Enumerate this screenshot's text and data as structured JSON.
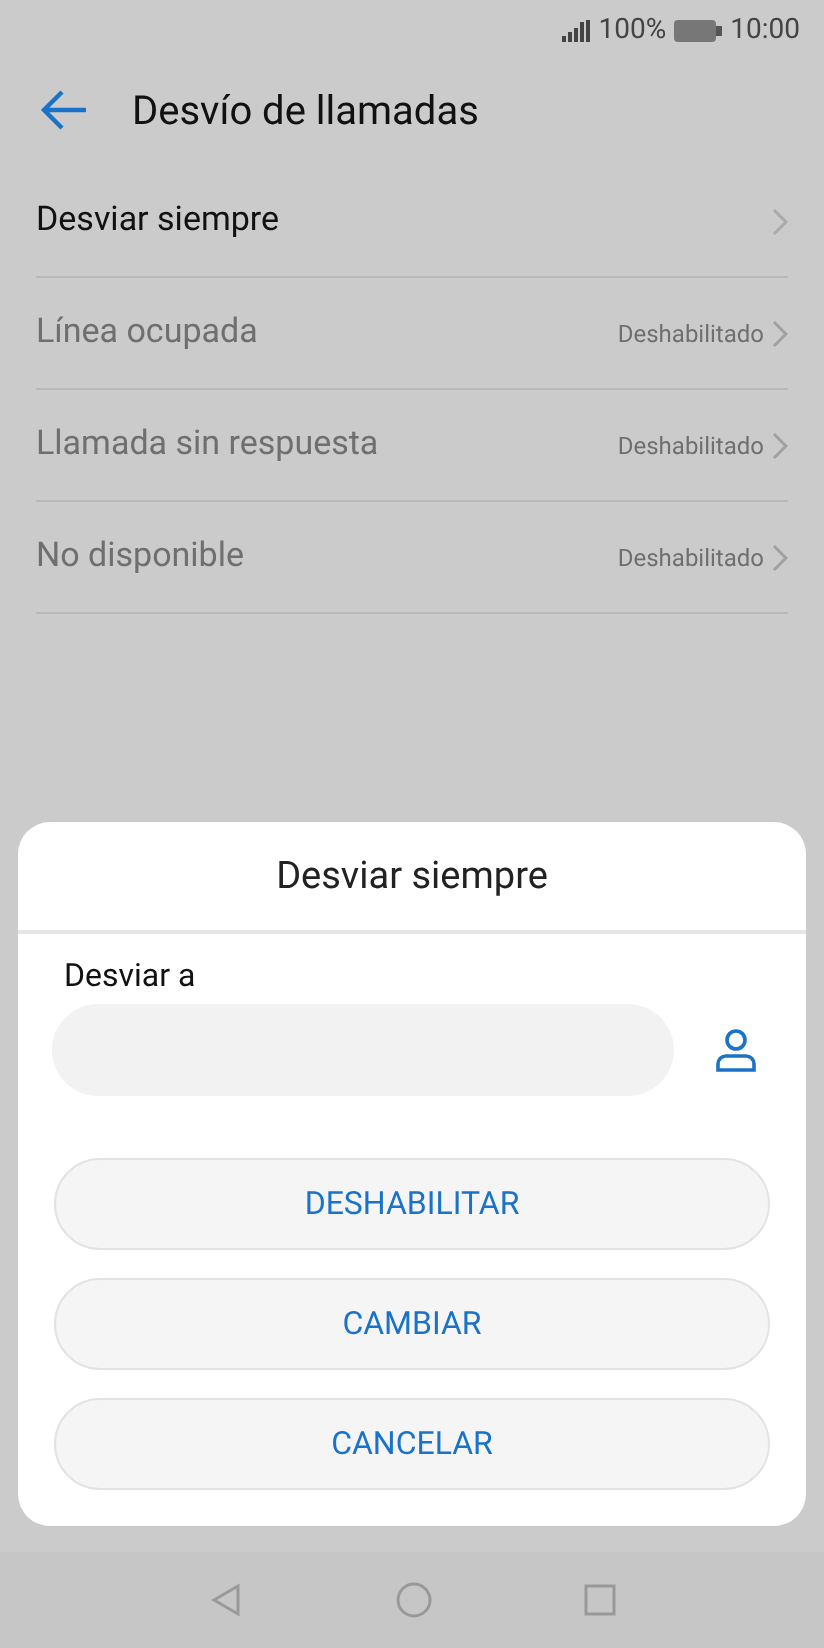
{
  "status_bar": {
    "battery": "100%",
    "time": "10:00"
  },
  "header": {
    "title": "Desvío de llamadas"
  },
  "items": [
    {
      "label": "Desviar siempre",
      "disabled": false
    },
    {
      "label": "Línea ocupada",
      "value": "Deshabilitado",
      "disabled": true
    },
    {
      "label": "Llamada sin respuesta",
      "value": "Deshabilitado",
      "disabled": true
    },
    {
      "label": "No disponible",
      "value": "Deshabilitado",
      "disabled": true
    }
  ],
  "dialog": {
    "title": "Desviar siempre",
    "field_label": "Desviar a",
    "buttons": [
      "DESHABILITAR",
      "CAMBIAR",
      "CANCELAR"
    ]
  }
}
